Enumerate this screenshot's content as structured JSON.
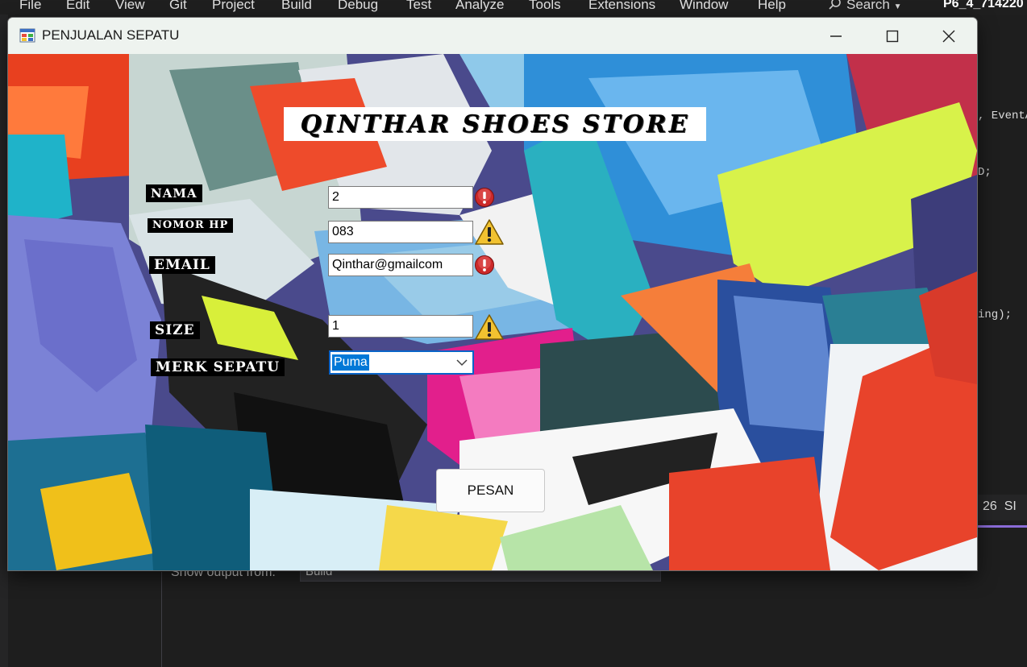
{
  "ide": {
    "menu": [
      "File",
      "Edit",
      "View",
      "Git",
      "Project",
      "Build",
      "Debug",
      "Test",
      "Analyze",
      "Tools",
      "Extensions",
      "Window",
      "Help"
    ],
    "search_label": "Search",
    "project_name": "P6_4_714220",
    "code_fragments": [
      ", EventA",
      "D;",
      "ing);"
    ],
    "output_label": "Show output from:",
    "output_source": "Build",
    "tab_fragment": "26  SI"
  },
  "window": {
    "title": "PENJUALAN SEPATU"
  },
  "form": {
    "store_title": "QINTHAR SHOES STORE",
    "labels": {
      "nama": "NAMA",
      "nomor_hp": "NOMOR HP",
      "email": "EMAIL",
      "size": "SIZE",
      "merk": "MERK SEPATU"
    },
    "values": {
      "nama": "2",
      "nomor_hp": "083",
      "email": "Qinthar@gmailcom",
      "size": "1",
      "merk": "Puma"
    },
    "validation": {
      "nama": "error",
      "nomor_hp": "warning",
      "email": "error",
      "size": "warning"
    },
    "submit_label": "PESAN"
  },
  "colors": {
    "error": "#cc2a2a",
    "warning": "#f2c230",
    "selection": "#0078d7"
  }
}
